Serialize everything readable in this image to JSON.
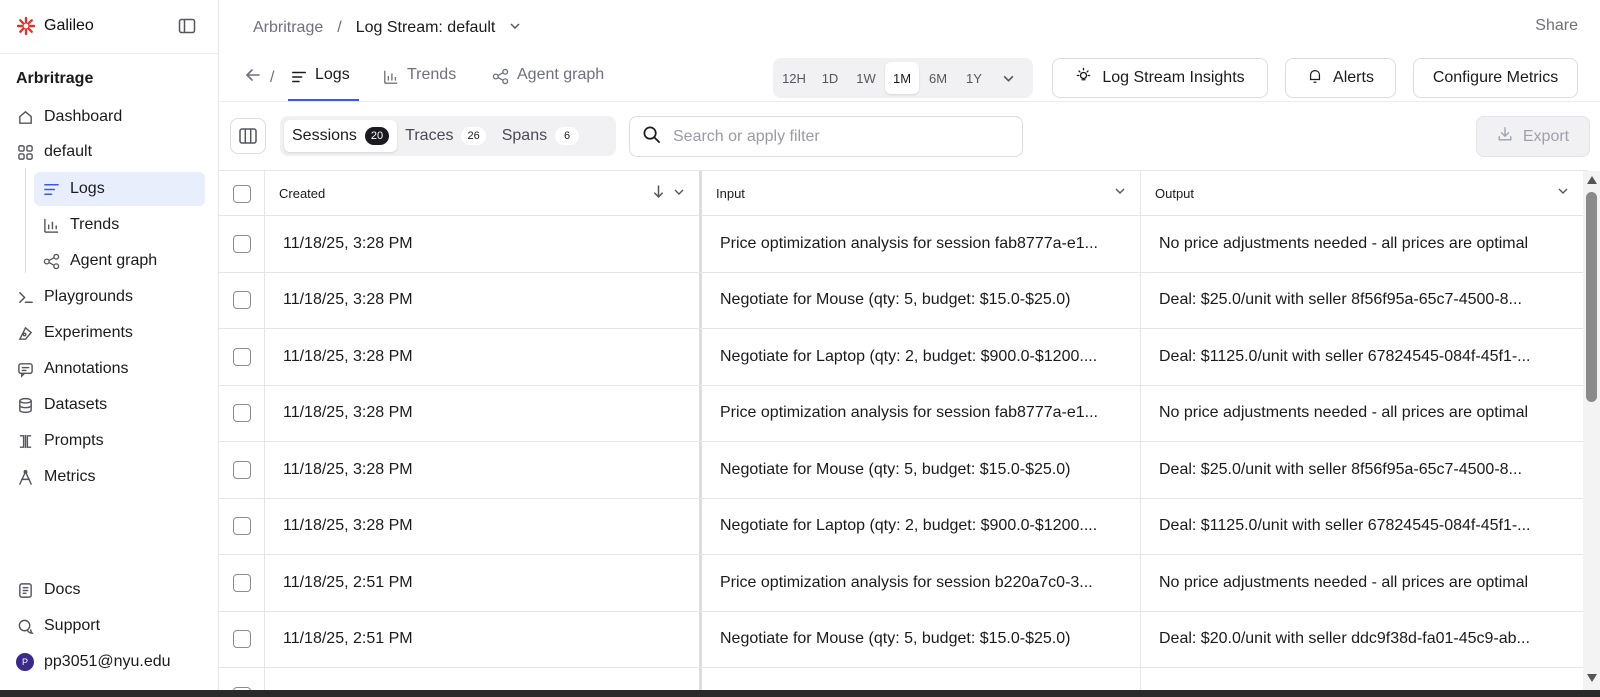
{
  "brand": {
    "name": "Galileo",
    "accent": "#e5322d"
  },
  "sidebar": {
    "project": "Arbritrage",
    "items": [
      {
        "label": "Dashboard",
        "icon": "home-icon"
      },
      {
        "label": "default",
        "icon": "grid-icon"
      },
      {
        "label": "Logs",
        "icon": "list-icon",
        "active": true
      },
      {
        "label": "Trends",
        "icon": "bar-chart-icon"
      },
      {
        "label": "Agent graph",
        "icon": "graph-icon"
      },
      {
        "label": "Playgrounds",
        "icon": "terminal-icon"
      },
      {
        "label": "Experiments",
        "icon": "flask-icon"
      },
      {
        "label": "Annotations",
        "icon": "annotation-icon"
      },
      {
        "label": "Datasets",
        "icon": "database-icon"
      },
      {
        "label": "Prompts",
        "icon": "prompt-icon"
      },
      {
        "label": "Metrics",
        "icon": "metrics-icon"
      }
    ],
    "footer": {
      "docs": "Docs",
      "support": "Support",
      "user_email": "pp3051@nyu.edu",
      "avatar_initial": "P"
    }
  },
  "header": {
    "breadcrumb_root": "Arbritrage",
    "breadcrumb_sep": "/",
    "breadcrumb_current": "Log Stream: default",
    "share": "Share"
  },
  "tabs": {
    "back_sep": "/",
    "items": [
      "Logs",
      "Trends",
      "Agent graph"
    ],
    "active": "Logs"
  },
  "time_range": {
    "options": [
      "12H",
      "1D",
      "1W",
      "1M",
      "6M",
      "1Y"
    ],
    "selected": "1M"
  },
  "actions": {
    "insights": "Log Stream Insights",
    "alerts": "Alerts",
    "configure": "Configure Metrics"
  },
  "toolbar": {
    "segments": [
      {
        "label": "Sessions",
        "count": "20",
        "active": true
      },
      {
        "label": "Traces",
        "count": "26"
      },
      {
        "label": "Spans",
        "count": "6"
      }
    ],
    "search_placeholder": "Search or apply filter",
    "export": "Export"
  },
  "table": {
    "columns": {
      "created": "Created",
      "input": "Input",
      "output": "Output"
    },
    "rows": [
      {
        "created": "11/18/25, 3:28 PM",
        "input": "Price optimization analysis for session fab8777a-e1...",
        "output": "No price adjustments needed - all prices are optimal"
      },
      {
        "created": "11/18/25, 3:28 PM",
        "input": "Negotiate for Mouse (qty: 5, budget: $15.0-$25.0)",
        "output": "Deal: $25.0/unit with seller 8f56f95a-65c7-4500-8..."
      },
      {
        "created": "11/18/25, 3:28 PM",
        "input": "Negotiate for Laptop (qty: 2, budget: $900.0-$1200....",
        "output": "Deal: $1125.0/unit with seller 67824545-084f-45f1-..."
      },
      {
        "created": "11/18/25, 3:28 PM",
        "input": "Price optimization analysis for session fab8777a-e1...",
        "output": "No price adjustments needed - all prices are optimal"
      },
      {
        "created": "11/18/25, 3:28 PM",
        "input": "Negotiate for Mouse (qty: 5, budget: $15.0-$25.0)",
        "output": "Deal: $25.0/unit with seller 8f56f95a-65c7-4500-8..."
      },
      {
        "created": "11/18/25, 3:28 PM",
        "input": "Negotiate for Laptop (qty: 2, budget: $900.0-$1200....",
        "output": "Deal: $1125.0/unit with seller 67824545-084f-45f1-..."
      },
      {
        "created": "11/18/25, 2:51 PM",
        "input": "Price optimization analysis for session b220a7c0-3...",
        "output": "No price adjustments needed - all prices are optimal"
      },
      {
        "created": "11/18/25, 2:51 PM",
        "input": "Negotiate for Mouse (qty: 5, budget: $15.0-$25.0)",
        "output": "Deal: $20.0/unit with seller ddc9f38d-fa01-45c9-ab..."
      }
    ]
  }
}
